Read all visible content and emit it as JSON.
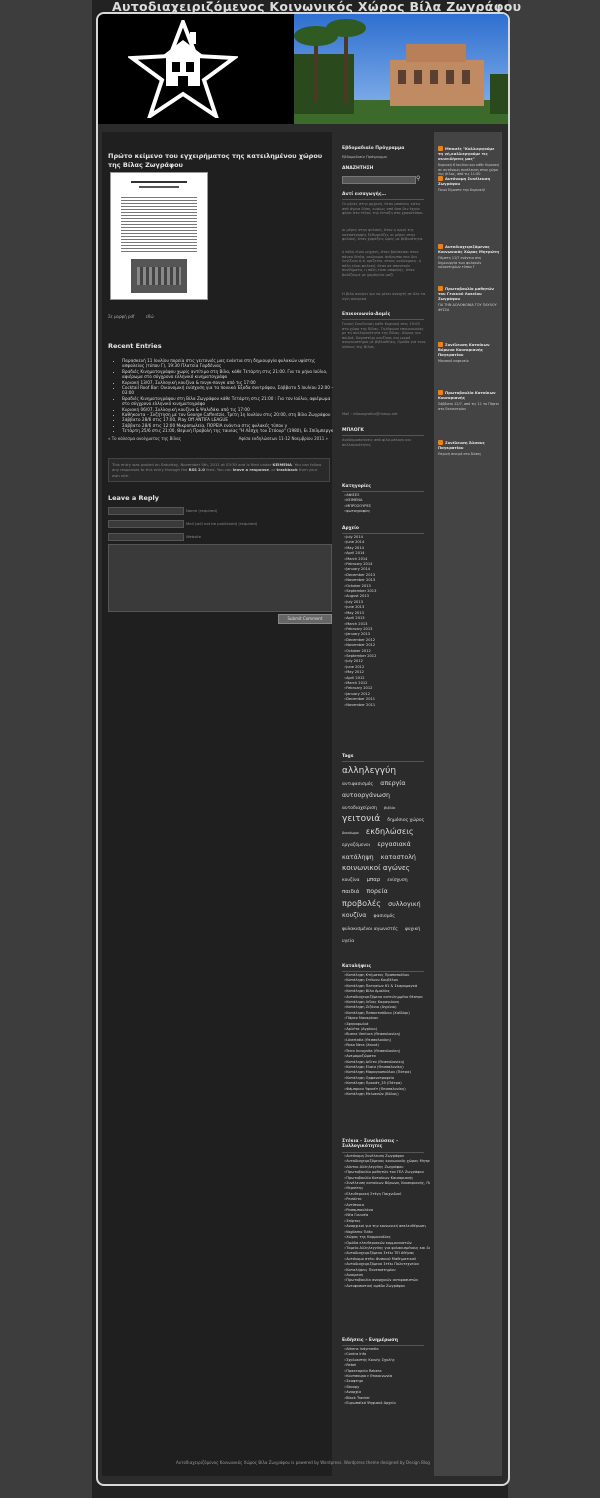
{
  "site_title": "Αυτοδιαχειριζόμενος Κοινωνικός Χώρος Βίλα Ζωγράφου",
  "post": {
    "title": "Πρώτο κείμενο του εγχειρήματος της κατειλημένου χώρου της Βίλας Ζωγράφου",
    "meta_links": [
      "Σε μορφή pdf",
      "εδώ"
    ]
  },
  "recent": {
    "heading": "Recent Entries",
    "items": [
      "Παρασκευή 11 Ιουλίου πορεία στις γειτονιές μας ενάντια στη δημιουργία φυλακών υψίστης ασφαλείας (τύπου Γ), 19:30 Πλατεία Γαρδένιας",
      "Βραδιές Κινηματογράφου χωρίς αντίτιμο στη Βίλα, κάθε Τετάρτη στις 21:00. Για το μήνα Ιούλιο, αφιέρωμα στο σύγχρονο ελληνικό κινηματογράφο",
      "Κυριακή 13/07, Συλλογική κουζίνα & πινγκ-πονγκ από τις 17:00",
      "Cocktail Roof Bar: Οικονομική ενίσχυση για τα ποινικά Έξοδα συντρόφου, Σάββατο 5 Ιουλίου 22:00 – 03:00",
      "Βραδιές Κινηματογράφου στη Βίλα Ζωγράφου κάθε Τετάρτη στις 21:00 : Για τον Ιούλιο, αφιέρωμα στο σύγχρονο ελληνικό κινηματογράφο",
      "Κυριακή 06/07, Συλλογική κουζίνα & Ψαλιδάκι από τις 17:00",
      "Καθήκοντα – Συζήτηση με τον George Caffentzis, Τρίτη 1η Ιουλίου στις 20:00, στη Βίλα Ζωγράφου",
      "Σάββατο 28/6 στις 17:00, Play Off ANTIFA LEAGUE",
      "Σάββατο 28/6 στις 12:00 Μικροπωλεία, ΠΟΡΕΙΑ ενάντια στις φυλακές τύπου γ",
      "Τετάρτη 25/6 στις 21:00, Θερινή Προβολή της ταινίας \"Η Λέσχη του Στόουρ\" (1980), Ει Σπίλμπεργκ"
    ]
  },
  "nav": {
    "prev": "« Το κάλεσμα ανοίγματος της Βίλας",
    "next": "Αφίσα εκδηλώσεων 11-12 Νοεμβρίου 2011 »"
  },
  "infobox": {
    "line1": "This entry was posted on Saturday, November 5th, 2011 at 03:30 and is filed under",
    "category": "ΚΕΙΜΕΝΑ",
    "line2": ". You can follow any responses to this entry through the",
    "feed": "RSS 2.0",
    "line3": "feed. You can",
    "respond": "leave a response",
    "line4": ", or",
    "trackback": "trackback",
    "line5": "from your own site."
  },
  "reply": {
    "heading": "Leave a Reply",
    "fields": [
      "Name (required)",
      "Mail (will not be published) (required)",
      "Website"
    ],
    "submit": "Submit Comment"
  },
  "sidebar1": {
    "program_h": "Εβδομαδιαίο Πρόγραμμα",
    "program_link": "Εβδομαδιαίο Πρόγραμμα",
    "search_h": "ΑΝΑΖΗΤΗΣΗ",
    "intro_h": "Αντί εισαγωγής…",
    "intro_p1": "Οι μέρες στην μηχανή, όταν μπαίνεις κάτω από άγρια δύση, κυρίως από όσα δεν έχουν φέρει στο τέλος την ένταξη στο χρονοτόπιο.",
    "intro_p2": "οι μέρες στην φυλακή, όταν η ορμή της καταστροφής ξεθωριάζει, οι μέρες στην φυλακή, όταν χαράζεις ώρες με βεβαιότητα.",
    "intro_p3": "η πόλη είναι μηχανή, όταν βρίσκεσαι στον πάγκο δίπλα, ανώνυμοι άνθρωποι που δεν λυγίζουν ό,τι ορίζεται, στους ανώνυμους. η πόλη είναι φυλακή, όταν σε απαντούν συνθήματα, η πόλη είναι ασφαλής, όταν βαδίζουμε με χαμόγελο μαζί",
    "intro_p4": "Η βίλα ανοίγει για να μένει ανοιχτή σε όλα τα υγιή ονειρικά",
    "contact_h": "Επικοινωνία-Δομές",
    "contact_p": "Γενική Συνέλευση κάθε Κυριακή στις 19:00 στο χώρο της Βίλας. Τηλέφωνο επικοινωνίας με τη συλλογικότητα της Βίλας. Χώρος για παιδιά, Εργαστήρι κουζίνας και μικρό αναγνωστήριο με βιβλιοθήκη, Ομάδα για τους κήπους της Βίλας.",
    "contact_mail": "Mail : villazografou@riseup.net",
    "links_h": "ΜΠΛΟΓΚ",
    "links_p": "Αναδημοσιεύσεις από φίλα μπλογκ και συλλογικότητες",
    "cats_h": "Κατηγορίες",
    "cats": [
      "ΑΦΙΣΕΣ",
      "ΚΕΙΜΕΝΑ",
      "ΜΠΡΟΣΟΥΡΕΣ",
      "φωτογραφίες"
    ],
    "archive_h": "Αρχείο",
    "archive": [
      "July 2014",
      "June 2014",
      "May 2014",
      "April 2014",
      "March 2014",
      "February 2014",
      "January 2014",
      "December 2013",
      "November 2013",
      "October 2013",
      "September 2013",
      "August 2013",
      "July 2013",
      "June 2013",
      "May 2013",
      "April 2013",
      "March 2013",
      "February 2013",
      "January 2013",
      "December 2012",
      "November 2012",
      "October 2012",
      "September 2012",
      "July 2012",
      "June 2012",
      "May 2012",
      "April 2012",
      "March 2012",
      "February 2012",
      "January 2012",
      "December 2011",
      "November 2011"
    ],
    "tags_h": "Tags",
    "tags": [
      {
        "t": "αλληλεγγύη",
        "s": 10
      },
      {
        "t": "αντιφασισμός",
        "s": 5
      },
      {
        "t": "απεργία",
        "s": 7
      },
      {
        "t": "αυτοοργάνωση",
        "s": 7
      },
      {
        "t": "αυτοδιαχείριση",
        "s": 5
      },
      {
        "t": "βιβλίο",
        "s": 4
      },
      {
        "t": "γειτονιά",
        "s": 10
      },
      {
        "t": "δημόσιος χώρος",
        "s": 5
      },
      {
        "t": "δικαίωμα",
        "s": 4
      },
      {
        "t": "εκδηλώσεις",
        "s": 9
      },
      {
        "t": "εργαζόμενοι",
        "s": 5
      },
      {
        "t": "εργασιακά",
        "s": 7
      },
      {
        "t": "κατάληψη",
        "s": 7
      },
      {
        "t": "καταστολή",
        "s": 7
      },
      {
        "t": "κοινωνικοί αγώνες",
        "s": 8
      },
      {
        "t": "κουζίνα",
        "s": 5
      },
      {
        "t": "μπαρ",
        "s": 6
      },
      {
        "t": "ενίσχυση",
        "s": 5
      },
      {
        "t": "παιδιά",
        "s": 6
      },
      {
        "t": "πορεία",
        "s": 7
      },
      {
        "t": "προβολές",
        "s": 9
      },
      {
        "t": "συλλογική κουζίνα",
        "s": 7
      },
      {
        "t": "φασισμός",
        "s": 5
      },
      {
        "t": "φυλακισμένοι αγωνιστές",
        "s": 5
      },
      {
        "t": "ψυχική υγεία",
        "s": 5
      }
    ],
    "categories_h": "Καταλήψεις",
    "categories": [
      "Κατάληψη Κτήματος Πραποπούλου",
      "Κατάληψη Στέκιου Κουβέλου",
      "Κατάληψη Πατησίων 61 & Σκαραμαγκά",
      "Κατάληψη Βίλα Αμαλίας",
      "Αυτοδιαχειριζόμενο κατειλημμένο θέατρο",
      "Κατάληψη Λέλας Καραγιάννη",
      "Κατάληψη Ζιζάνιο (Αγρίνιο)",
      "Κατάληψη Παπουτσάδικο (Χαϊδάρι)",
      "Πάρκο Ναυαρίνου",
      "Σφηκοφωλιά",
      "Αρλέτα (Αγρίνιο)",
      "Buena Ventura (Θεσσαλονίκη)",
      "Libertatia (Θεσσαλονίκη)",
      "Rosa Nera (Χανιά)",
      "Terra Incognita (Θεσσαλονίκη)",
      "Ανεμομαζώματα",
      "Κατάληψη Δέλτα (Θεσσαλονίκη)",
      "Κατάληψη Ελαία (Θεσσαλονίκη)",
      "Κατάληψη Μαραγκοπούλου (Πάτρα)",
      "Κατάληψη Ορφανοτροφείο",
      "Κατάληψη Προκάτ_35 (Πάτρα)",
      "Φάμπρικα Υφανέτ (Θεσσαλονίκη)",
      "Κατάληψη Μελισσών (Βόλος)"
    ],
    "groups_h": "Στέκια – Συνελεύσεις – Συλλογικότητες",
    "groups": [
      "Αυτόνομη Συνέλευση Ζωγράφου",
      "Αυτοδιαχειριζόμενος κοινωνικός χώρος Μητρώτη",
      "Δίκτυο Αλληλεγγύης Ζωγράφου",
      "Πρωτοβουλία μαθητών του ΓΕΛ Ζωγράφου",
      "Πρωτοβουλία Κατοίκων Καισαριανής",
      "Συνέλευση κατοίκων Βύρωνα, Καισαριανής, Παγκρατίου",
      "Θερσίτης",
      "Ελευθεριακή Στέγη Παιχνιδιού",
      "Ρεσάλτο",
      "Αντίπνοια",
      "Ρασαμπουλάνα",
      "Νέα Γουινέα",
      "Σπίρτος",
      "Αναρχικοί για την κοινωνική απελευθέρωση",
      "Vogliamo Tutto",
      "Χώρος της Καρμανιόλας",
      "Ομάδα ελευθεριακών κομμουνιστών",
      "Ταμείο Αλληλεγγύης για φυλακισμένους και διωκόμενους αγωνιστές",
      "Αυτοδιαχειριζόμενο Στέκι ΤΕΙ Αθήνας",
      "Αυτόνομο στέκι Φυσικού Μαθηματικού",
      "Αυτοδιαχειριζόμενο Στέκι Πολυτεχνείου",
      "Καταλήψεις Πανεπιστημίου",
      "Αναιρεση",
      "Πρωτοβουλία αναρχικών αντιφασιστών",
      "Αντιφασιστική ομάδα Ζωγράφου"
    ],
    "news_h": "Ειδήσεις – Ενημέρωση",
    "news": [
      "Athens Indymedia",
      "Contra Info",
      "Σχολιαστής Κοινής Σχολής",
      "Rebel",
      "Πρακτορείο Rabera",
      "Κουτσουρο ε Επικοινωνία",
      "Σκαφτηρι",
      "Skoopy",
      "Αναρχία",
      "Black Tracker",
      "Ευρωπαϊκό Ψηφιακό Αρχείο"
    ]
  },
  "sidebar2": [
    {
      "title": "Μποσές \"Καλλιεργούμε τη γή,καλλιεργούμε τις συνειδήσεις μας\"",
      "body": "Κυριακή 6 Ιουλίου και κάθε Κυριακή σε αυτόνομη συνέλευση στον χώρο της βίλας, από τις 11:00"
    },
    {
      "title": "Αυτόνομη Συνέλευση Ζωγράφου",
      "body": "Ποιοί Είμαστε την Κυριακή!"
    },
    {
      "title": "Αυτοδιαχειριζόμενος Κοινωνικός Χώρος Μητρώτη",
      "body": "Πέμπτη 11/7 ενάντια στη δημιουργία των φυλακών κολαστηρίων τύπου Γ"
    },
    {
      "title": "Πρωτοβουλία μαθητών του Γενικού Λυκείου Ζωγράφου",
      "body": "ΓΙΑ ΤΗΝ ΔΟΛΟΦΟΝΙΑ ΤΟΥ ΠΑΥΛΟΥ ΦΥΣΣΑ"
    },
    {
      "title": "Συνέλευση Κατοίκων Βύρωνα Καισαριανής Παγκρατίου",
      "body": "Μουσικό καφενείο"
    },
    {
      "title": "Πρωτοβουλία Κατοίκων Καισαριανής",
      "body": "Σάββατο 12/7, από τις 11 το Πάρτυ στο Εκεσιοτρίου"
    },
    {
      "title": "Συνέλευση Άλσους Παγκρατίου",
      "body": "Θερινή σινεμά στο Άλσος"
    }
  ],
  "footer": "Αυτοδιαχειριζόμενος Κοινωνικός Χώρος Βίλα Ζωγράφου is powered by Wordpress. Wordpress theme designed by Design Blog",
  "colors": {
    "page_bg": "#3d3d3d",
    "frame": "#d8d8d8",
    "content_bg": "#1f1f1f",
    "rss": "#e8821c"
  }
}
